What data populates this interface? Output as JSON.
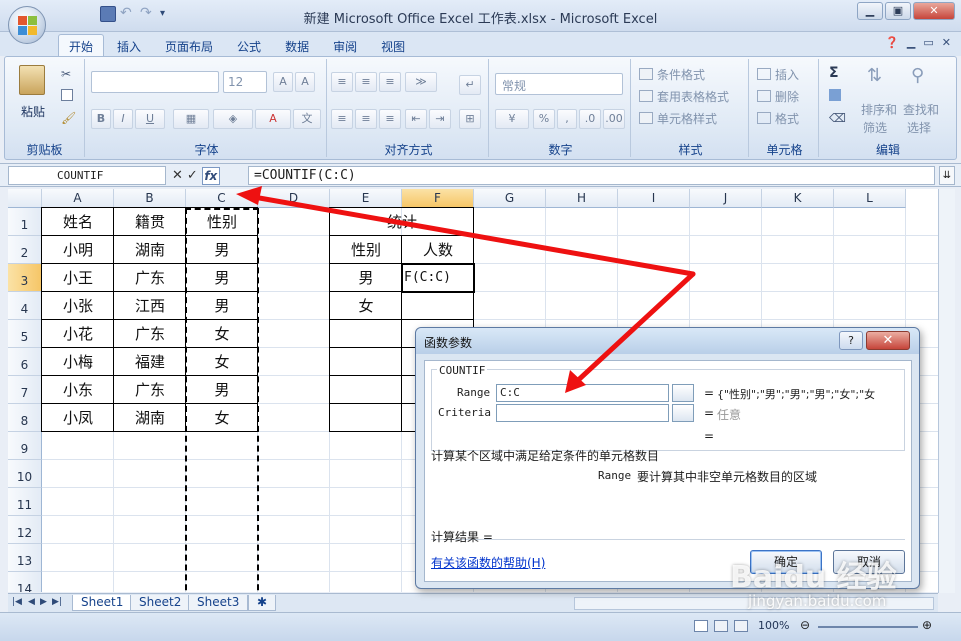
{
  "window": {
    "title": "新建 Microsoft Office Excel 工作表.xlsx - Microsoft Excel",
    "minimize": "▁",
    "restore": "▣",
    "close": "✕"
  },
  "ribbon": {
    "tabs": [
      "开始",
      "插入",
      "页面布局",
      "公式",
      "数据",
      "审阅",
      "视图"
    ],
    "active_tab": "开始",
    "groups": {
      "clipboard": {
        "label": "剪贴板",
        "paste": "粘贴"
      },
      "font": {
        "label": "字体",
        "size": "12",
        "bold": "B",
        "italic": "I",
        "underline": "U"
      },
      "alignment": {
        "label": "对齐方式"
      },
      "number": {
        "label": "数字",
        "format": "常规",
        "percent": "%"
      },
      "styles": {
        "label": "样式",
        "conditional": "条件格式",
        "table": "套用表格格式",
        "cell": "单元格样式"
      },
      "cells": {
        "label": "单元格",
        "insert": "插入",
        "delete": "删除",
        "format": "格式"
      },
      "editing": {
        "label": "编辑",
        "sort1": "排序和",
        "sort2": "筛选",
        "find1": "查找和",
        "find2": "选择"
      }
    }
  },
  "formula_bar": {
    "name_box": "COUNTIF",
    "fx": "fx",
    "formula": "=COUNTIF(C:C)"
  },
  "sheet": {
    "columns": [
      "A",
      "B",
      "C",
      "D",
      "E",
      "F",
      "G",
      "H",
      "I",
      "J",
      "K",
      "L"
    ],
    "rows": [
      "1",
      "2",
      "3",
      "4",
      "5",
      "6",
      "7",
      "8",
      "9",
      "10",
      "11",
      "12",
      "13",
      "14"
    ],
    "table1": {
      "headers": [
        "姓名",
        "籍贯",
        "性别"
      ],
      "rows": [
        [
          "小明",
          "湖南",
          "男"
        ],
        [
          "小王",
          "广东",
          "男"
        ],
        [
          "小张",
          "江西",
          "男"
        ],
        [
          "小花",
          "广东",
          "女"
        ],
        [
          "小梅",
          "福建",
          "女"
        ],
        [
          "小东",
          "广东",
          "男"
        ],
        [
          "小凤",
          "湖南",
          "女"
        ]
      ]
    },
    "table2": {
      "title": "统计",
      "headers": [
        "性别",
        "人数"
      ],
      "rows": [
        [
          "男",
          "F(C:C)"
        ],
        [
          "女",
          ""
        ]
      ]
    },
    "sheet_tabs": [
      "Sheet1",
      "Sheet2",
      "Sheet3"
    ]
  },
  "status": {
    "zoom": "100%"
  },
  "dialog": {
    "title": "函数参数",
    "help_btn": "?",
    "close_btn": "✕",
    "function_name": "COUNTIF",
    "args": [
      {
        "label": "Range",
        "value": "C:C",
        "result": "{\"性别\";\"男\";\"男\";\"男\";\"女\";\"女"
      },
      {
        "label": "Criteria",
        "value": "",
        "result": "任意"
      }
    ],
    "equals": "=",
    "description": "计算某个区域中满足给定条件的单元格数目",
    "arg_help_name": "Range",
    "arg_help_text": "要计算其中非空单元格数目的区域",
    "result_label": "计算结果 =",
    "help_link": "有关该函数的帮助(H)",
    "ok": "确定",
    "cancel": "取消"
  },
  "watermark": {
    "brand": "Baidu 经验",
    "url": "jingyan.baidu.com"
  },
  "colors": {
    "accent": "#15428b",
    "arrow": "#ee1111",
    "selected_header": "#f6c667"
  }
}
